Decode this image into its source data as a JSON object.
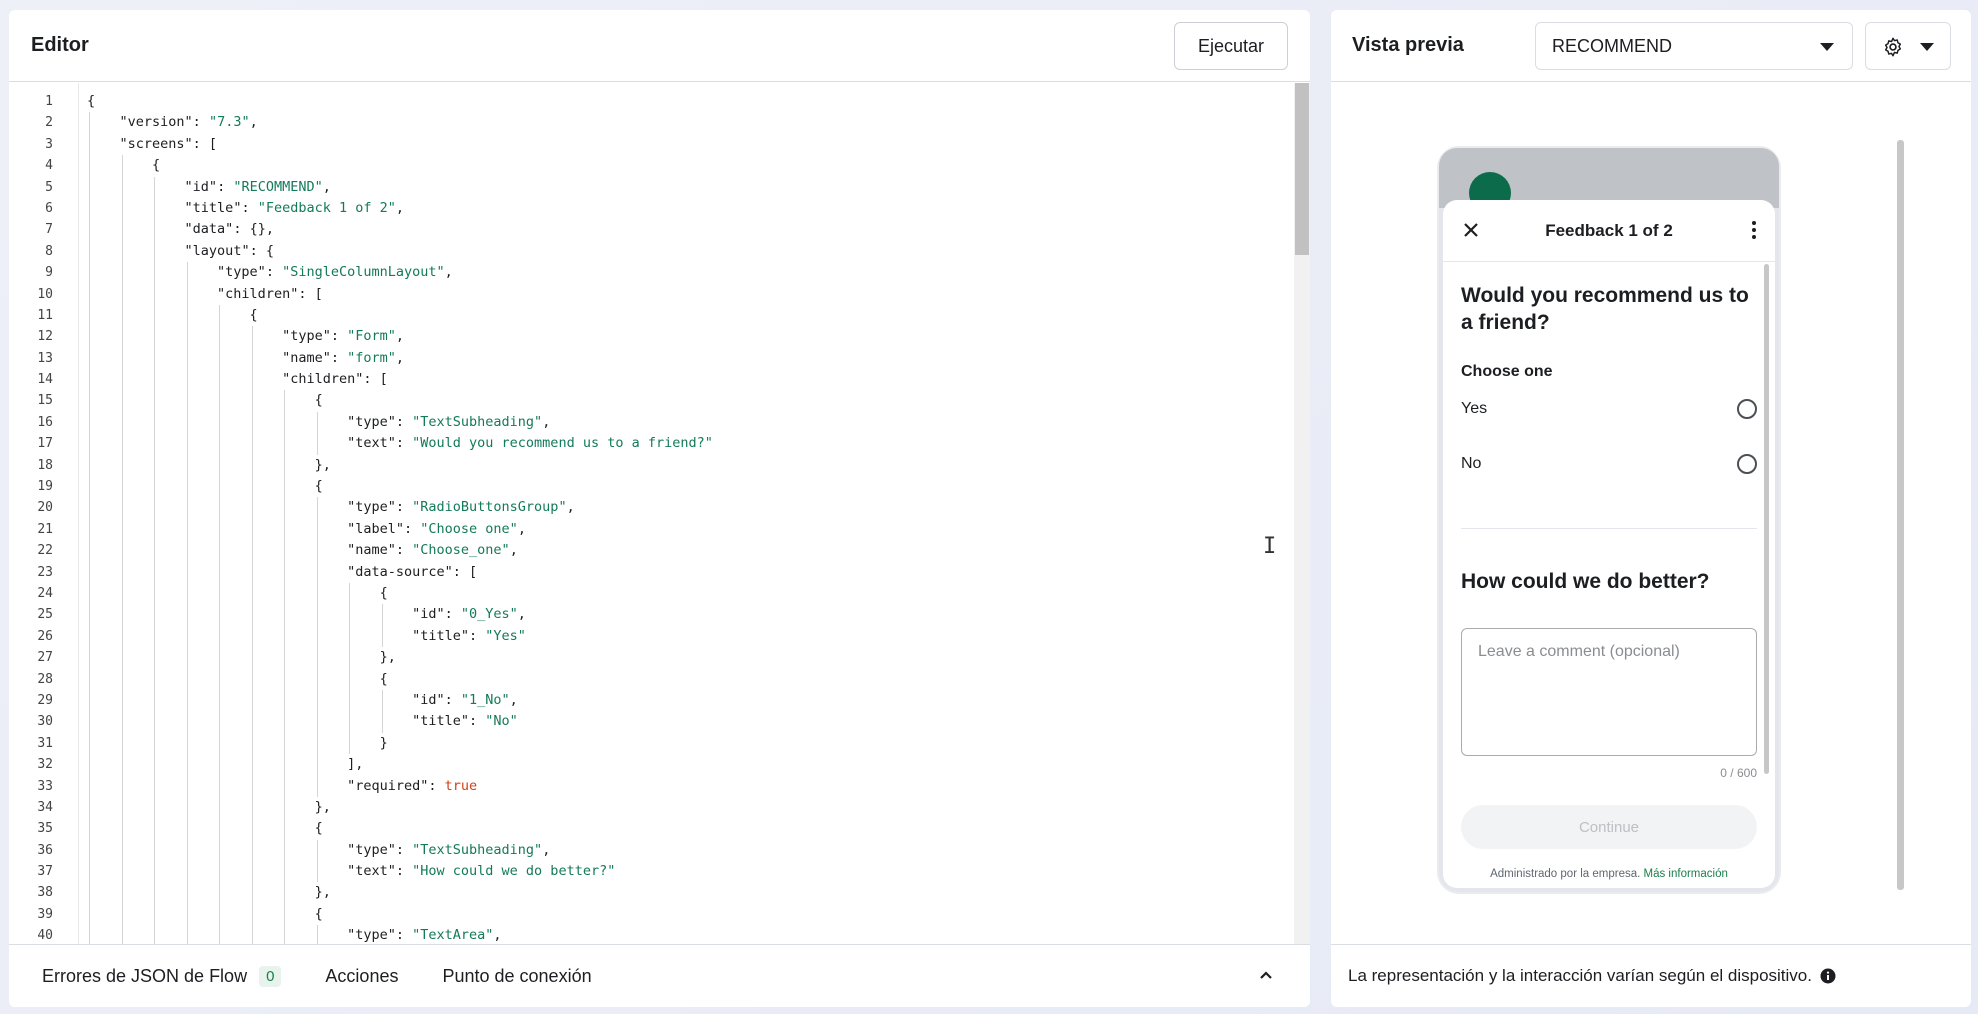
{
  "editor": {
    "title": "Editor",
    "run_label": "Ejecutar",
    "lines": [
      [
        [
          "p",
          "{"
        ]
      ],
      [
        [
          "p",
          "    "
        ],
        [
          "k",
          "\"version\""
        ],
        [
          "p",
          ": "
        ],
        [
          "s",
          "\"7.3\""
        ],
        [
          "p",
          ","
        ]
      ],
      [
        [
          "p",
          "    "
        ],
        [
          "k",
          "\"screens\""
        ],
        [
          "p",
          ": ["
        ]
      ],
      [
        [
          "p",
          "        {"
        ]
      ],
      [
        [
          "p",
          "            "
        ],
        [
          "k",
          "\"id\""
        ],
        [
          "p",
          ": "
        ],
        [
          "s",
          "\"RECOMMEND\""
        ],
        [
          "p",
          ","
        ]
      ],
      [
        [
          "p",
          "            "
        ],
        [
          "k",
          "\"title\""
        ],
        [
          "p",
          ": "
        ],
        [
          "s",
          "\"Feedback 1 of 2\""
        ],
        [
          "p",
          ","
        ]
      ],
      [
        [
          "p",
          "            "
        ],
        [
          "k",
          "\"data\""
        ],
        [
          "p",
          ": {},"
        ]
      ],
      [
        [
          "p",
          "            "
        ],
        [
          "k",
          "\"layout\""
        ],
        [
          "p",
          ": {"
        ]
      ],
      [
        [
          "p",
          "                "
        ],
        [
          "k",
          "\"type\""
        ],
        [
          "p",
          ": "
        ],
        [
          "s",
          "\"SingleColumnLayout\""
        ],
        [
          "p",
          ","
        ]
      ],
      [
        [
          "p",
          "                "
        ],
        [
          "k",
          "\"children\""
        ],
        [
          "p",
          ": ["
        ]
      ],
      [
        [
          "p",
          "                    {"
        ]
      ],
      [
        [
          "p",
          "                        "
        ],
        [
          "k",
          "\"type\""
        ],
        [
          "p",
          ": "
        ],
        [
          "s",
          "\"Form\""
        ],
        [
          "p",
          ","
        ]
      ],
      [
        [
          "p",
          "                        "
        ],
        [
          "k",
          "\"name\""
        ],
        [
          "p",
          ": "
        ],
        [
          "s",
          "\"form\""
        ],
        [
          "p",
          ","
        ]
      ],
      [
        [
          "p",
          "                        "
        ],
        [
          "k",
          "\"children\""
        ],
        [
          "p",
          ": ["
        ]
      ],
      [
        [
          "p",
          "                            {"
        ]
      ],
      [
        [
          "p",
          "                                "
        ],
        [
          "k",
          "\"type\""
        ],
        [
          "p",
          ": "
        ],
        [
          "s",
          "\"TextSubheading\""
        ],
        [
          "p",
          ","
        ]
      ],
      [
        [
          "p",
          "                                "
        ],
        [
          "k",
          "\"text\""
        ],
        [
          "p",
          ": "
        ],
        [
          "s",
          "\"Would you recommend us to a friend?\""
        ]
      ],
      [
        [
          "p",
          "                            },"
        ]
      ],
      [
        [
          "p",
          "                            {"
        ]
      ],
      [
        [
          "p",
          "                                "
        ],
        [
          "k",
          "\"type\""
        ],
        [
          "p",
          ": "
        ],
        [
          "s",
          "\"RadioButtonsGroup\""
        ],
        [
          "p",
          ","
        ]
      ],
      [
        [
          "p",
          "                                "
        ],
        [
          "k",
          "\"label\""
        ],
        [
          "p",
          ": "
        ],
        [
          "s",
          "\"Choose one\""
        ],
        [
          "p",
          ","
        ]
      ],
      [
        [
          "p",
          "                                "
        ],
        [
          "k",
          "\"name\""
        ],
        [
          "p",
          ": "
        ],
        [
          "s",
          "\"Choose_one\""
        ],
        [
          "p",
          ","
        ]
      ],
      [
        [
          "p",
          "                                "
        ],
        [
          "k",
          "\"data-source\""
        ],
        [
          "p",
          ": ["
        ]
      ],
      [
        [
          "p",
          "                                    {"
        ]
      ],
      [
        [
          "p",
          "                                        "
        ],
        [
          "k",
          "\"id\""
        ],
        [
          "p",
          ": "
        ],
        [
          "s",
          "\"0_Yes\""
        ],
        [
          "p",
          ","
        ]
      ],
      [
        [
          "p",
          "                                        "
        ],
        [
          "k",
          "\"title\""
        ],
        [
          "p",
          ": "
        ],
        [
          "s",
          "\"Yes\""
        ]
      ],
      [
        [
          "p",
          "                                    },"
        ]
      ],
      [
        [
          "p",
          "                                    {"
        ]
      ],
      [
        [
          "p",
          "                                        "
        ],
        [
          "k",
          "\"id\""
        ],
        [
          "p",
          ": "
        ],
        [
          "s",
          "\"1_No\""
        ],
        [
          "p",
          ","
        ]
      ],
      [
        [
          "p",
          "                                        "
        ],
        [
          "k",
          "\"title\""
        ],
        [
          "p",
          ": "
        ],
        [
          "s",
          "\"No\""
        ]
      ],
      [
        [
          "p",
          "                                    }"
        ]
      ],
      [
        [
          "p",
          "                                ],"
        ]
      ],
      [
        [
          "p",
          "                                "
        ],
        [
          "k",
          "\"required\""
        ],
        [
          "p",
          ": "
        ],
        [
          "b",
          "true"
        ]
      ],
      [
        [
          "p",
          "                            },"
        ]
      ],
      [
        [
          "p",
          "                            {"
        ]
      ],
      [
        [
          "p",
          "                                "
        ],
        [
          "k",
          "\"type\""
        ],
        [
          "p",
          ": "
        ],
        [
          "s",
          "\"TextSubheading\""
        ],
        [
          "p",
          ","
        ]
      ],
      [
        [
          "p",
          "                                "
        ],
        [
          "k",
          "\"text\""
        ],
        [
          "p",
          ": "
        ],
        [
          "s",
          "\"How could we do better?\""
        ]
      ],
      [
        [
          "p",
          "                            },"
        ]
      ],
      [
        [
          "p",
          "                            {"
        ]
      ],
      [
        [
          "p",
          "                                "
        ],
        [
          "k",
          "\"type\""
        ],
        [
          "p",
          ": "
        ],
        [
          "s",
          "\"TextArea\""
        ],
        [
          "p",
          ","
        ]
      ]
    ],
    "bottom_tabs": {
      "errors_label": "Errores de JSON de Flow",
      "errors_count": "0",
      "actions_label": "Acciones",
      "endpoint_label": "Punto de conexión"
    }
  },
  "preview": {
    "title": "Vista previa",
    "screen_selected": "RECOMMEND",
    "phone": {
      "header_title": "Feedback 1 of 2",
      "question1": "Would you recommend us to a friend?",
      "choose_label": "Choose one",
      "options": [
        "Yes",
        "No"
      ],
      "question2": "How could we do better?",
      "comment_placeholder": "Leave a comment (opcional)",
      "counter": "0 / 600",
      "continue_label": "Continue",
      "managed_text": "Administrado por la empresa.",
      "more_info": "Más información"
    },
    "footer_text": "La representación y la interacción varían según el dispositivo."
  },
  "icons": {
    "settings": "gear-icon",
    "dropdown": "chevron-down-icon",
    "close": "close-icon",
    "more": "more-vertical-icon",
    "info": "info-icon",
    "collapse": "chevron-up-icon"
  }
}
